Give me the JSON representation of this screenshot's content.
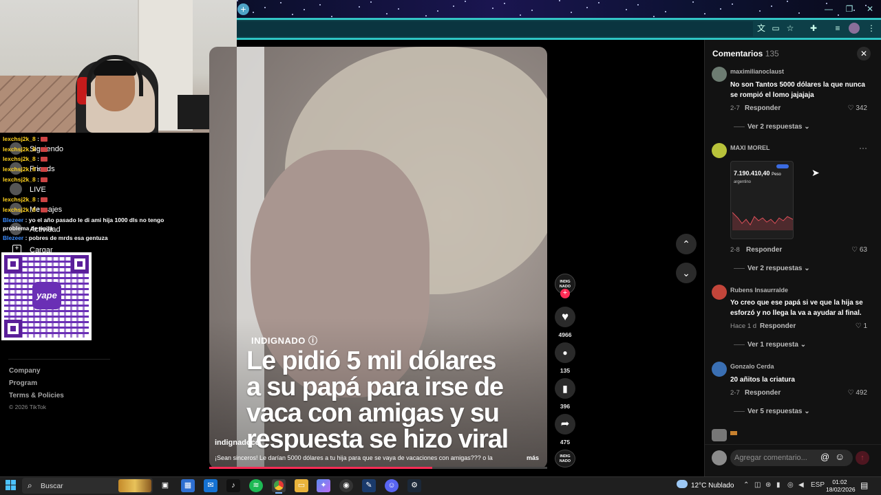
{
  "browser": {
    "new_tab_icon": "+",
    "window_controls": {
      "minimize": "—",
      "restore": "❐",
      "close": "✕"
    },
    "toolbar_icons": [
      "translate-icon",
      "cast-icon",
      "bookmark-star-icon",
      "extensions-icon",
      "media-control-icon",
      "profile-icon",
      "menu-icon"
    ]
  },
  "stream_overlay": {
    "chat": [
      {
        "user": "lexchsj2k_8",
        "sep": " :"
      },
      {
        "user": "lexchsj2k_8",
        "sep": " :"
      },
      {
        "user": "lexchsj2k_8",
        "sep": " :"
      },
      {
        "user": "lexchsj2k_8",
        "sep": " :"
      },
      {
        "user": "lexchsj2k_8",
        "sep": " :"
      },
      {
        "user": "lexchsj2k_8",
        "sep": " :"
      },
      {
        "user": "lexchsj2k_8",
        "sep": " :"
      }
    ],
    "chat_long": [
      {
        "user": "Blezeer",
        "message": " : yo el año pasado le di ami hija 1000 dls no tengo"
      },
      {
        "user": "",
        "message": "problema de nada"
      },
      {
        "user": "Blezeer",
        "message": " : pobres de mrds esa gentuza"
      }
    ],
    "qr_label": "yape"
  },
  "sidebar": {
    "nav": [
      "Siguiendo",
      "Friends",
      "LIVE",
      "Mensajes",
      "Actividad",
      "Cargar"
    ],
    "footer_links": [
      "Company",
      "Program",
      "Terms & Policies"
    ],
    "copyright": "© 2026 TikTok"
  },
  "video": {
    "brand": "INDIGNADO ⓘ",
    "headline": [
      "Le pidió 5 mil dólares",
      "a su papá para irse de",
      "vaca con amigas y su",
      "respuesta se hizo viral"
    ],
    "author": "indignadoco",
    "description": "¡Sean sinceros! Le darían 5000 dólares a tu hija para que se vaya de vacaciones con amigas??? o la",
    "more": "más",
    "progress": 0.66
  },
  "actions": {
    "avatar_text": "INDIG NADO",
    "follow": "+",
    "likes": "4966",
    "comments": "135",
    "saves": "396",
    "shares": "475",
    "icons": {
      "like": "♥",
      "comment": "●",
      "save": "▮",
      "share": "➦"
    }
  },
  "nav_arrows": {
    "up": "⌃",
    "down": "⌄"
  },
  "comments": {
    "title": "Comentarios",
    "count": "135",
    "close": "✕",
    "items": [
      {
        "user": "maximilianoclaust",
        "text": "No son Tantos 5000 dólares la que nunca se rompió el lomo jajajaja",
        "date": "2-7",
        "reply": "Responder",
        "likes": "342",
        "replies": "Ver 2 respuestas ⌄"
      },
      {
        "user": "MAXI MOREL",
        "text": "",
        "date": "2-8",
        "reply": "Responder",
        "likes": "63",
        "replies": "Ver 2 respuestas ⌄",
        "image_price": "7.190.410,40",
        "image_unit": "Peso",
        "image_sub": "argentino"
      },
      {
        "user": "Rubens Insaurralde",
        "text": "Yo creo que ese papá si ve que la hija se esforzó y no llega la va a ayudar al final.",
        "date": "Hace 1 d",
        "reply": "Responder",
        "likes": "1",
        "replies": "Ver 1 respuesta ⌄"
      },
      {
        "user": "Gonzalo Cerda",
        "text": "20 añitos la criatura",
        "date": "2-7",
        "reply": "Responder",
        "likes": "492",
        "replies": "Ver 5 respuestas ⌄"
      }
    ],
    "more_dots": "···",
    "input_placeholder": "Agregar comentario...",
    "at": "@",
    "emoji": "☺",
    "send": "↑"
  },
  "taskbar": {
    "search_placeholder": "Buscar",
    "weather_temp": "12°C",
    "weather_desc": "Nublado",
    "lang": "ESP",
    "time": "01:02",
    "date": "18/02/2026"
  },
  "colors": {
    "accent": "#fe2c55",
    "cyan": "#33c6c6",
    "panel": "#121212"
  }
}
